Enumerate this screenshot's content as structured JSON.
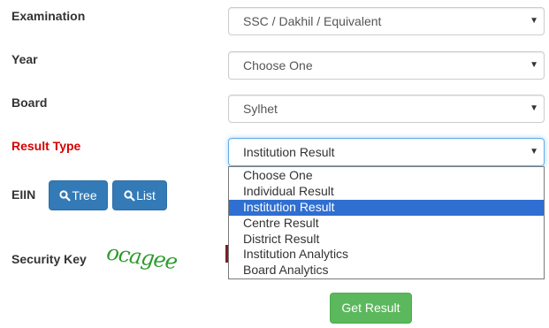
{
  "form": {
    "examination": {
      "label": "Examination",
      "value": "SSC / Dakhil / Equivalent"
    },
    "year": {
      "label": "Year",
      "value": "Choose One"
    },
    "board": {
      "label": "Board",
      "value": "Sylhet"
    },
    "result_type": {
      "label": "Result Type",
      "value": "Institution Result",
      "options": [
        "Choose One",
        "Individual Result",
        "Institution Result",
        "Centre Result",
        "District Result",
        "Institution Analytics",
        "Board Analytics"
      ],
      "highlighted": "Institution Result"
    },
    "eiin": {
      "label": "EIIN",
      "tree_button": "Tree",
      "list_button": "List"
    },
    "security_key": {
      "label": "Security Key",
      "captcha_text": "ocagee"
    },
    "submit_label": "Get Result"
  },
  "colors": {
    "required_label": "#d50000",
    "primary_button": "#337ab7",
    "success_button": "#5cb85c",
    "option_highlight": "#2f6fd1",
    "captcha": "#2e9b2e"
  },
  "icons": {
    "search": "search-icon",
    "dropdown_arrow": "caret-down-icon"
  }
}
